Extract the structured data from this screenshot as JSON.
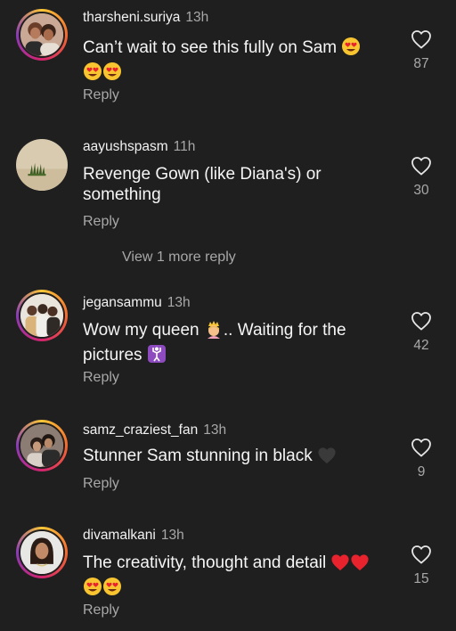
{
  "comments": [
    {
      "username": "tharsheni.suriya",
      "time": "13h",
      "text": "Can’t wait to see this fully on Sam 😍😍😍",
      "text_main": "Can’t wait to see this fully on Sam",
      "likes": "87",
      "reply_label": "Reply",
      "avatar_icon": "avatar-two-women-photo"
    },
    {
      "username": "aayushspasm",
      "time": "11h",
      "text_main": "Revenge Gown (like Diana's) or something",
      "likes": "30",
      "reply_label": "Reply",
      "avatar_icon": "avatar-grass-landscape"
    },
    {
      "username": "jegansammu",
      "time": "13h",
      "text_a": "Wow my queen",
      "text_b": ".. Waiting for the pictures",
      "likes": "42",
      "reply_label": "Reply",
      "avatar_icon": "avatar-group-photo"
    },
    {
      "username": "samz_craziest_fan",
      "time": "13h",
      "text_main": "Stunner Sam stunning in black",
      "likes": "9",
      "reply_label": "Reply",
      "avatar_icon": "avatar-couple-photo"
    },
    {
      "username": "divamalkani",
      "time": "13h",
      "text_main": "The creativity, thought and detail",
      "likes": "15",
      "reply_label": "Reply",
      "avatar_icon": "avatar-woman-portrait"
    }
  ],
  "view_more_replies": "View 1 more reply",
  "colors": {
    "background": "#1f1f1f",
    "text": "#f5f5f5",
    "secondary": "#a8a8a8",
    "heart_red": "#e8232e",
    "black_heart": "#3a3a3a"
  }
}
